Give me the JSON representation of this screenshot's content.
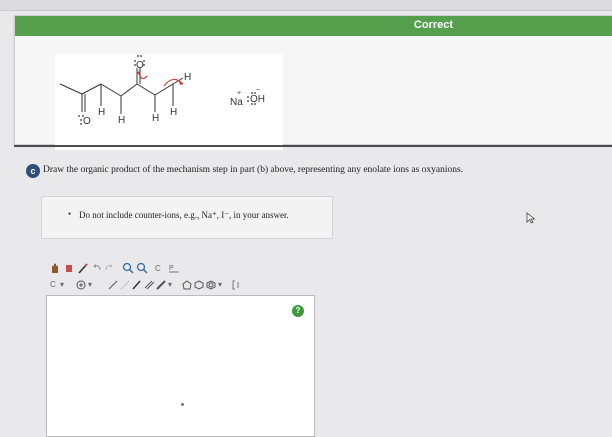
{
  "feedback": {
    "status": "Correct",
    "molecule": {
      "atom_O_carbonyl": "O",
      "atom_O_top": "O",
      "h_labels": [
        "H",
        "H",
        "H",
        "H",
        "H"
      ],
      "reagent_na": "Na",
      "reagent_na_charge": "+",
      "reagent_oh": "OH",
      "reagent_oh_charge": "−"
    },
    "colors": {
      "banner": "#56a04d",
      "arrow": "#d23b2f"
    }
  },
  "part_c": {
    "badge": "c",
    "question": "Draw the organic product of the mechanism step in part (b) above, representing any enolate ions as oxyanions."
  },
  "note": {
    "bullet": "•",
    "text": "Do not include counter-ions, e.g., Na⁺, I⁻, in your answer."
  },
  "toolbar": {
    "tools_row1": [
      "hand-icon",
      "eraser-icon",
      "pencil-icon",
      "undo-icon",
      "redo-icon",
      "zoom-in-icon",
      "zoom-out-icon",
      "clean-icon",
      "template-icon"
    ],
    "label_c": "C",
    "label_h": "H",
    "tools_row2": [
      "atom-select",
      "charge-select",
      "single-bond",
      "double-bond",
      "triple-bond",
      "bond-select",
      "ring-cyclopentane",
      "ring-cyclohexane",
      "ring-select",
      "bracket-tool"
    ]
  },
  "canvas": {
    "help_label": "?"
  }
}
